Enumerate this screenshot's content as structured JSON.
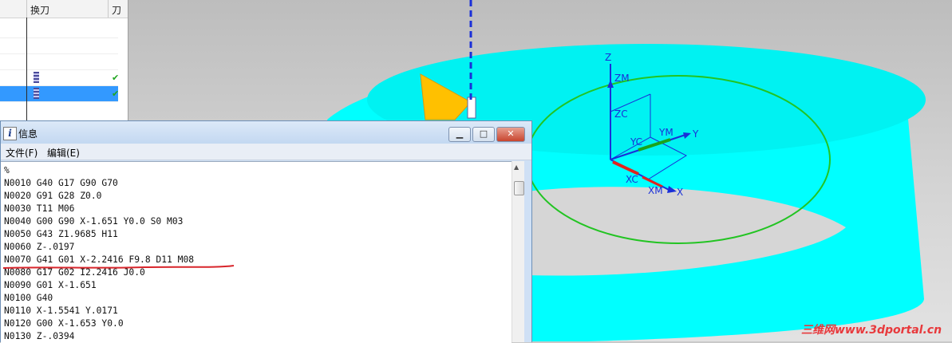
{
  "navigator": {
    "columns": [
      "换刀",
      "刀"
    ],
    "rows": [
      {
        "selected": false,
        "tool_icon": false,
        "check": false
      },
      {
        "selected": false,
        "tool_icon": false,
        "check": false
      },
      {
        "selected": false,
        "tool_icon": false,
        "check": false
      },
      {
        "selected": false,
        "tool_icon": true,
        "check": true
      },
      {
        "selected": true,
        "tool_icon": true,
        "check": true
      }
    ]
  },
  "info_window": {
    "title": "信息",
    "icon_glyph": "i",
    "buttons": {
      "minimize": "▁",
      "maximize": "□",
      "close": "✕"
    },
    "menu": [
      "文件(F)",
      "编辑(E)"
    ],
    "lines": [
      "%",
      "N0010 G40 G17 G90 G70",
      "N0020 G91 G28 Z0.0",
      "N0030 T11 M06",
      "N0040 G00 G90 X-1.651 Y0.0 S0 M03",
      "N0050 G43 Z1.9685 H11",
      "N0060 Z-.0197",
      "N0070 G41 G01 X-2.2416 F9.8 D11 M08",
      "N0080 G17 G02 I2.2416 J0.0",
      "N0090 G01 X-1.651",
      "N0100 G40",
      "N0110 X-1.5541 Y.0171",
      "N0120 G00 X-1.653 Y0.0",
      "N0130 Z-.0394"
    ],
    "highlighted_line_index": 7
  },
  "viewport": {
    "axis_labels": {
      "z": "Z",
      "zm": "ZM",
      "zc": "ZC",
      "ym": "YM",
      "y": "Y",
      "yc": "YC",
      "xc": "XC",
      "xm": "XM",
      "x": "X"
    },
    "part_color": "#00ffff",
    "toolpath_color": "#22c422",
    "tool_color": "#ffc000"
  },
  "watermark": {
    "cn": "三维网",
    "url": "www.3dportal.cn"
  }
}
